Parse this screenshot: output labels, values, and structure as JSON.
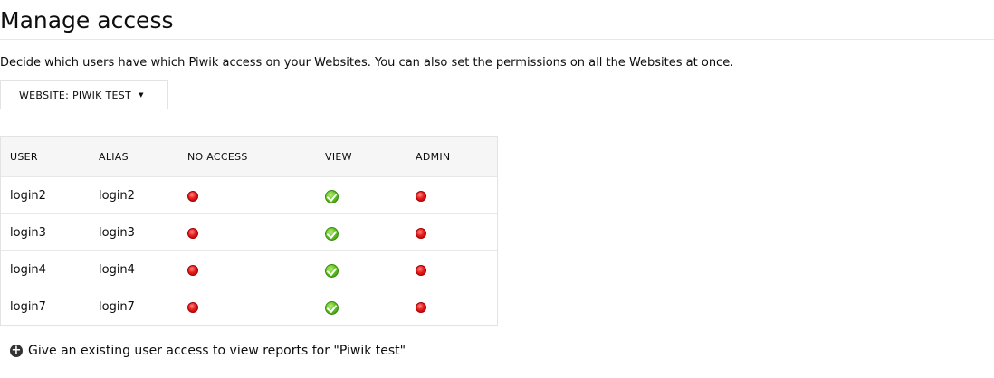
{
  "page": {
    "title": "Manage access",
    "intro": "Decide which users have which Piwik access on your Websites. You can also set the permissions on all the Websites at once."
  },
  "site_selector": {
    "label": "WEBSITE: PIWIK TEST",
    "caret_icon": "caret-down-icon"
  },
  "table": {
    "headers": {
      "user": "USER",
      "alias": "ALIAS",
      "no_access": "NO ACCESS",
      "view": "VIEW",
      "admin": "ADMIN"
    },
    "rows": [
      {
        "user": "login2",
        "alias": "login2",
        "access": "view"
      },
      {
        "user": "login3",
        "alias": "login3",
        "access": "view"
      },
      {
        "user": "login4",
        "alias": "login4",
        "access": "view"
      },
      {
        "user": "login7",
        "alias": "login7",
        "access": "view"
      }
    ],
    "icons": {
      "granted": "green-check-circle-icon",
      "not_granted": "red-dot-icon"
    }
  },
  "give_access": {
    "icon": "plus-circle-icon",
    "label": "Give an existing user access to view reports for \"Piwik test\""
  },
  "colors": {
    "granted": "#5cc01c",
    "not_granted": "#e61d1d",
    "header_bg": "#f6f6f6",
    "border": "#e3e3e3"
  }
}
